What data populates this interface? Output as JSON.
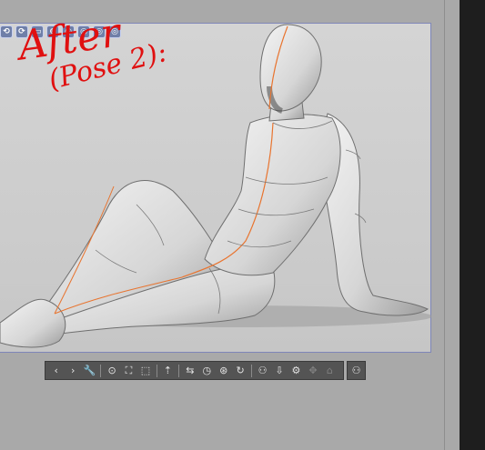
{
  "annotation": {
    "line1": "After",
    "line2": "(Pose 2):"
  },
  "top_tools": [
    "⟲",
    "⟳",
    "▭",
    "⊕",
    "◎",
    "◎",
    "◎",
    "◎"
  ],
  "toolbar": {
    "icons": [
      {
        "name": "prev-arrow-icon",
        "glyph": "‹"
      },
      {
        "name": "next-arrow-icon",
        "glyph": "›"
      },
      {
        "name": "wrench-icon",
        "glyph": "🔧"
      },
      {
        "name": "camera-icon",
        "glyph": "⊙"
      },
      {
        "name": "fit-view-icon",
        "glyph": "⛶"
      },
      {
        "name": "ground-icon",
        "glyph": "⬚"
      },
      {
        "name": "figure-up-icon",
        "glyph": "⇡"
      },
      {
        "name": "flip-icon",
        "glyph": "⇆"
      },
      {
        "name": "reset-pose-icon",
        "glyph": "◷"
      },
      {
        "name": "zoom-joint-icon",
        "glyph": "⊛"
      },
      {
        "name": "rotate-joint-icon",
        "glyph": "↻"
      },
      {
        "name": "pose-figures-icon",
        "glyph": "⚇"
      },
      {
        "name": "import-pose-icon",
        "glyph": "⇩"
      },
      {
        "name": "gear-icon",
        "glyph": "⚙"
      },
      {
        "name": "move-icon",
        "glyph": "✥"
      },
      {
        "name": "lock-icon",
        "glyph": "⌂"
      }
    ],
    "end_icon": "⚇"
  }
}
